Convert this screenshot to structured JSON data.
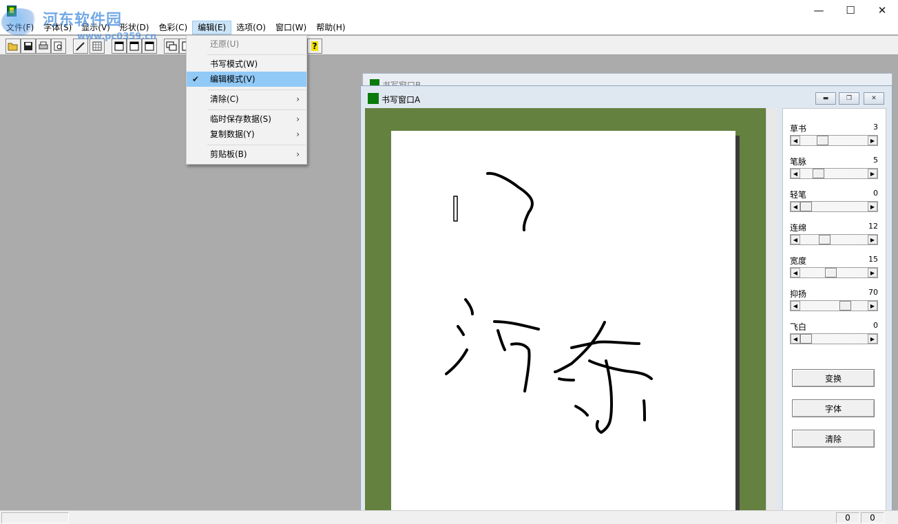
{
  "watermark": {
    "text": "河东软件园",
    "url": "www.pc0359.cn"
  },
  "window_controls": {
    "minimize": "—",
    "maximize": "☐",
    "close": "✕"
  },
  "menubar": {
    "items": [
      {
        "label": "文件(F)"
      },
      {
        "label": "字体(S)"
      },
      {
        "label": "显示(V)"
      },
      {
        "label": "形状(D)"
      },
      {
        "label": "色彩(C)"
      },
      {
        "label": "编辑(E)"
      },
      {
        "label": "选项(O)"
      },
      {
        "label": "窗口(W)"
      },
      {
        "label": "帮助(H)"
      }
    ],
    "active_index": 5
  },
  "toolbar": {
    "buttons": [
      "open-icon",
      "save-icon",
      "print-icon",
      "print-preview-icon",
      "pen-icon",
      "grid-icon",
      "window-icon",
      "window-icon",
      "window-icon",
      "cascade-icon",
      "tile-icon",
      "help-icon"
    ],
    "help_glyph": "?"
  },
  "dropdown": {
    "items": [
      {
        "label": "还原(U)",
        "disabled": true
      },
      {
        "label": "书写模式(W)"
      },
      {
        "label": "编辑模式(V)",
        "checked": true
      },
      {
        "label": "清除(C)",
        "submenu": true
      },
      {
        "label": "临时保存数据(S)",
        "submenu": true
      },
      {
        "label": "复制数据(Y)",
        "submenu": true
      },
      {
        "label": "剪贴板(B)",
        "submenu": true
      }
    ],
    "check_glyph": "✔",
    "arrow_glyph": "›"
  },
  "window_b": {
    "title": "书写窗口B"
  },
  "window_a": {
    "title": "书写窗口A",
    "controls": {
      "minimize": "▬",
      "restore": "❐",
      "close": "✕"
    },
    "paper_color": "#ffffff",
    "background_color": "#648140"
  },
  "controls": [
    {
      "label": "草书",
      "value": "3",
      "level": 0.3
    },
    {
      "label": "笔脉",
      "value": "5",
      "level": 0.22
    },
    {
      "label": "轻笔",
      "value": "0",
      "level": 0.0
    },
    {
      "label": "连绵",
      "value": "12",
      "level": 0.33
    },
    {
      "label": "宽度",
      "value": "15",
      "level": 0.45
    },
    {
      "label": "抑扬",
      "value": "70",
      "level": 0.7
    },
    {
      "label": "飞白",
      "value": "0",
      "level": 0.0
    }
  ],
  "panel_buttons": [
    {
      "label": "变换"
    },
    {
      "label": "字体"
    },
    {
      "label": "清除"
    }
  ],
  "statusbar": {
    "cell1": "0",
    "cell2": "0"
  }
}
